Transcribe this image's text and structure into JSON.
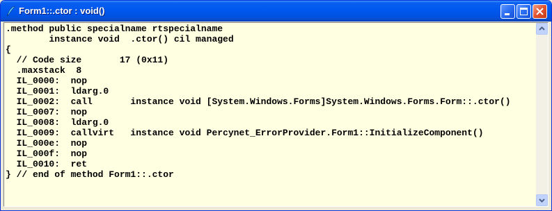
{
  "window": {
    "title": "Form1::.ctor : void()",
    "icon": "quill-pen-icon"
  },
  "title_buttons": {
    "minimize": "minimize-icon",
    "maximize": "maximize-icon",
    "close": "close-icon"
  },
  "code": {
    "lines": [
      ".method public specialname rtspecialname",
      "        instance void  .ctor() cil managed",
      "{",
      "  // Code size       17 (0x11)",
      "  .maxstack  8",
      "  IL_0000:  nop",
      "  IL_0001:  ldarg.0",
      "  IL_0002:  call       instance void [System.Windows.Forms]System.Windows.Forms.Form::.ctor()",
      "  IL_0007:  nop",
      "  IL_0008:  ldarg.0",
      "  IL_0009:  callvirt   instance void Percynet_ErrorProvider.Form1::InitializeComponent()",
      "  IL_000e:  nop",
      "  IL_000f:  nop",
      "  IL_0010:  ret",
      "} // end of method Form1::.ctor"
    ]
  },
  "colors": {
    "editor_background": "#ffffe1",
    "titlebar": "#0058ee"
  }
}
